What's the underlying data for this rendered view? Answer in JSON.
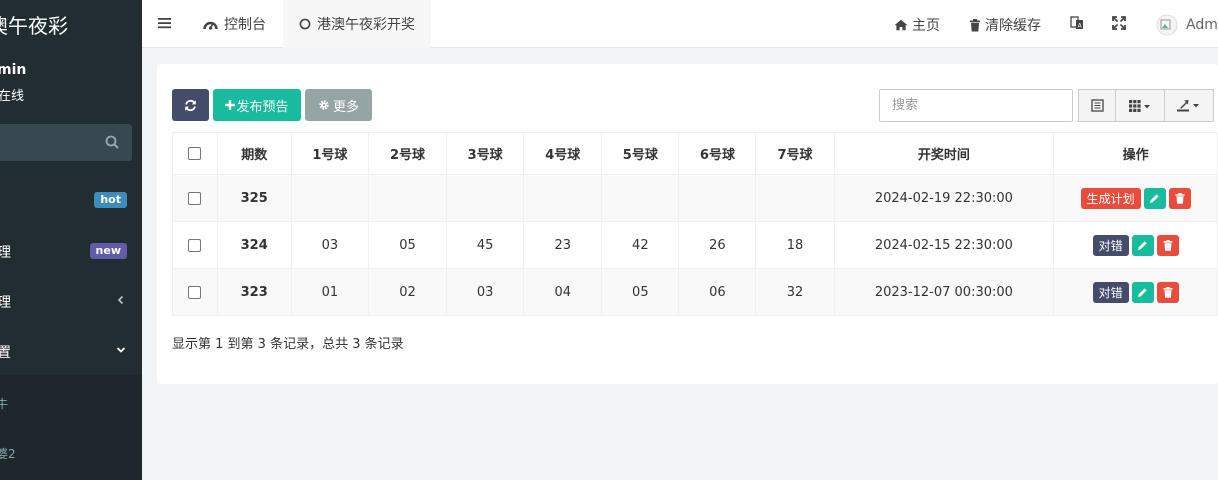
{
  "sidebar": {
    "brand": "澳午夜彩",
    "user_name": "min",
    "user_status": "在线",
    "items": [
      {
        "label": "",
        "badge": "hot"
      },
      {
        "label": "理",
        "badge": "new"
      },
      {
        "label": "理"
      },
      {
        "label": "置"
      }
    ],
    "submenu": [
      "牛",
      "婆2"
    ]
  },
  "topbar": {
    "tabs": [
      {
        "label": "控制台"
      },
      {
        "label": "港澳午夜彩开奖"
      }
    ],
    "home_label": "主页",
    "clear_cache_label": "清除缓存",
    "user_label": "Adm"
  },
  "toolbar": {
    "publish_label": "发布预告",
    "more_label": "更多",
    "search_placeholder": "搜索"
  },
  "table": {
    "headers": [
      "期数",
      "1号球",
      "2号球",
      "3号球",
      "4号球",
      "5号球",
      "6号球",
      "7号球",
      "开奖时间",
      "操作"
    ],
    "rows": [
      {
        "issue": "325",
        "balls": [
          "",
          "",
          "",
          "",
          "",
          "",
          ""
        ],
        "time": "2024-02-19 22:30:00",
        "action": "生成计划"
      },
      {
        "issue": "324",
        "balls": [
          "03",
          "05",
          "45",
          "23",
          "42",
          "26",
          "18"
        ],
        "time": "2024-02-15 22:30:00",
        "action": "对错"
      },
      {
        "issue": "323",
        "balls": [
          "01",
          "02",
          "03",
          "04",
          "05",
          "06",
          "32"
        ],
        "time": "2023-12-07 00:30:00",
        "action": "对错"
      }
    ]
  },
  "pager": {
    "info": "显示第 1 到第 3 条记录，总共 3 条记录"
  },
  "colors": {
    "sidebar_bg": "#222d32",
    "primary": "#18bc9c",
    "danger": "#e74c3c",
    "info": "#444c69",
    "hot_badge": "#3c8dbc",
    "new_badge": "#605ca8"
  }
}
